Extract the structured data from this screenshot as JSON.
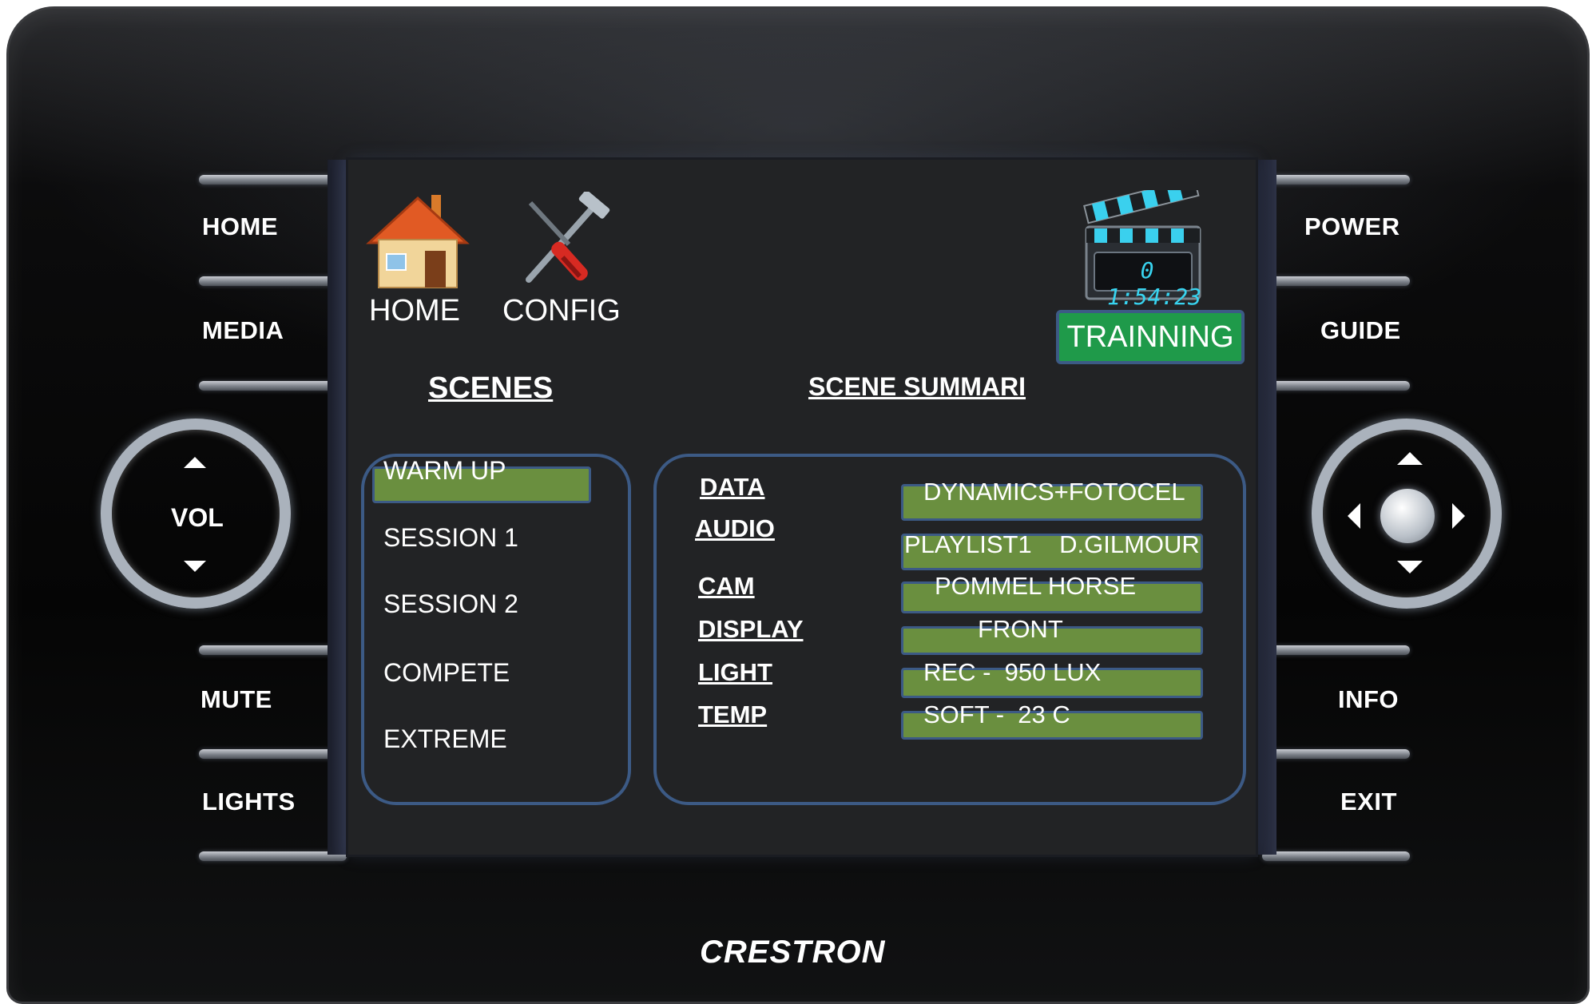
{
  "hardware": {
    "left_buttons": [
      "HOME",
      "MEDIA",
      "MUTE",
      "LIGHTS"
    ],
    "right_buttons": [
      "POWER",
      "GUIDE",
      "INFO",
      "EXIT"
    ],
    "vol_label": "VOL",
    "brand": "CRESTRON"
  },
  "screen": {
    "home_label": "HOME",
    "config_label": "CONFIG",
    "clock": "0 1:54:23",
    "mode_button": "TRAINNING",
    "scenes_title": "SCENES",
    "summary_title": "SCENE SUMMARI",
    "scenes": [
      "WARM UP",
      "SESSION 1",
      "SESSION 2",
      "COMPETE",
      "EXTREME"
    ],
    "summary": [
      {
        "label": "DATA",
        "value": "DYNAMICS+FOTOCEL"
      },
      {
        "label": "AUDIO",
        "value": "PLAYLIST1    D.GILMOUR"
      },
      {
        "label": "CAM",
        "value": "POMMEL HORSE"
      },
      {
        "label": "DISPLAY",
        "value": "FRONT"
      },
      {
        "label": "LIGHT",
        "value": "REC -  950 LUX"
      },
      {
        "label": "TEMP",
        "value": "SOFT -  23 C"
      }
    ]
  },
  "colors": {
    "accent_green": "#6a8f3f",
    "mode_green": "#1f9a4a",
    "panel_border": "#3c5a85",
    "clock_cyan": "#38d4f0"
  }
}
